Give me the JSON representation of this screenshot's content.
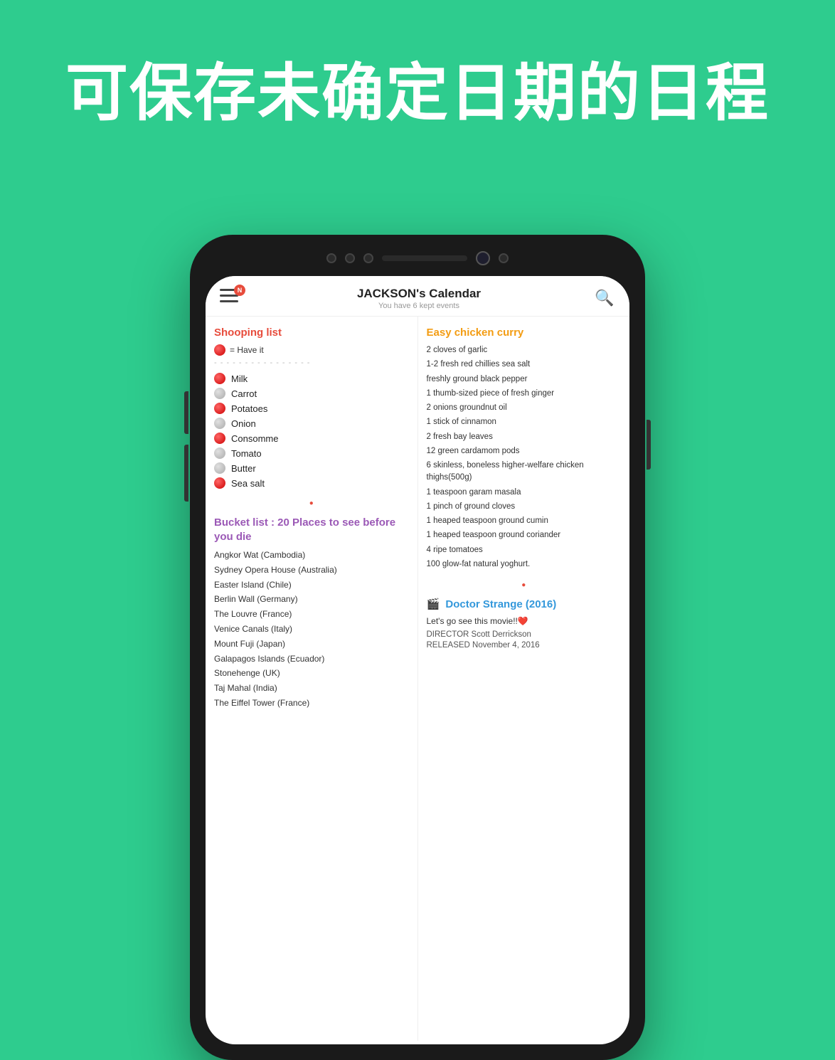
{
  "page": {
    "background_color": "#2ecc8e",
    "hero_text": "可保存未确定日期的日程"
  },
  "app": {
    "header": {
      "title": "JACKSON's Calendar",
      "subtitle": "You have 6 kept events",
      "notification_count": "N"
    },
    "left_column": {
      "shopping_list": {
        "title": "Shooping list",
        "legend": "🔴 = Have it",
        "divider": "- - - - - - - - - - - - - - - -",
        "items": [
          {
            "name": "Milk",
            "have": true
          },
          {
            "name": "Carrot",
            "have": false
          },
          {
            "name": "Potatoes",
            "have": true
          },
          {
            "name": "Onion",
            "have": false
          },
          {
            "name": "Consomme",
            "have": true
          },
          {
            "name": "Tomato",
            "have": false
          },
          {
            "name": "Butter",
            "have": false
          },
          {
            "name": "Sea salt",
            "have": true
          }
        ]
      },
      "bucket_list": {
        "title": "Bucket list : 20 Places to see before you die",
        "items": [
          "Angkor Wat (Cambodia)",
          "Sydney Opera House (Australia)",
          "Easter Island (Chile)",
          "Berlin Wall (Germany)",
          "The Louvre (France)",
          "Venice Canals (Italy)",
          "Mount Fuji (Japan)",
          "Galapagos Islands (Ecuador)",
          "Stonehenge (UK)",
          "Taj Mahal (India)",
          "The Eiffel Tower (France)"
        ]
      }
    },
    "right_column": {
      "recipe": {
        "title": "Easy chicken curry",
        "ingredients": [
          "2 cloves of garlic",
          "1-2 fresh red chillies sea salt",
          "freshly ground black pepper",
          "1 thumb-sized piece of fresh ginger",
          "2 onions groundnut oil",
          "1 stick of cinnamon",
          "2 fresh bay leaves",
          "12 green cardamom pods",
          "6 skinless, boneless higher-welfare chicken thighs(500g)",
          "1 teaspoon garam masala",
          "1 pinch of ground cloves",
          "1 heaped teaspoon ground cumin",
          "1 heaped teaspoon ground coriander",
          "4 ripe tomatoes",
          "100 glow-fat natural yoghurt."
        ]
      },
      "movie": {
        "title": "Doctor Strange (2016)",
        "icon": "🎬",
        "note": "Let's go see this movie!!❤️",
        "director": "DIRECTOR Scott Derrickson",
        "released": "RELEASED November 4, 2016"
      }
    }
  }
}
